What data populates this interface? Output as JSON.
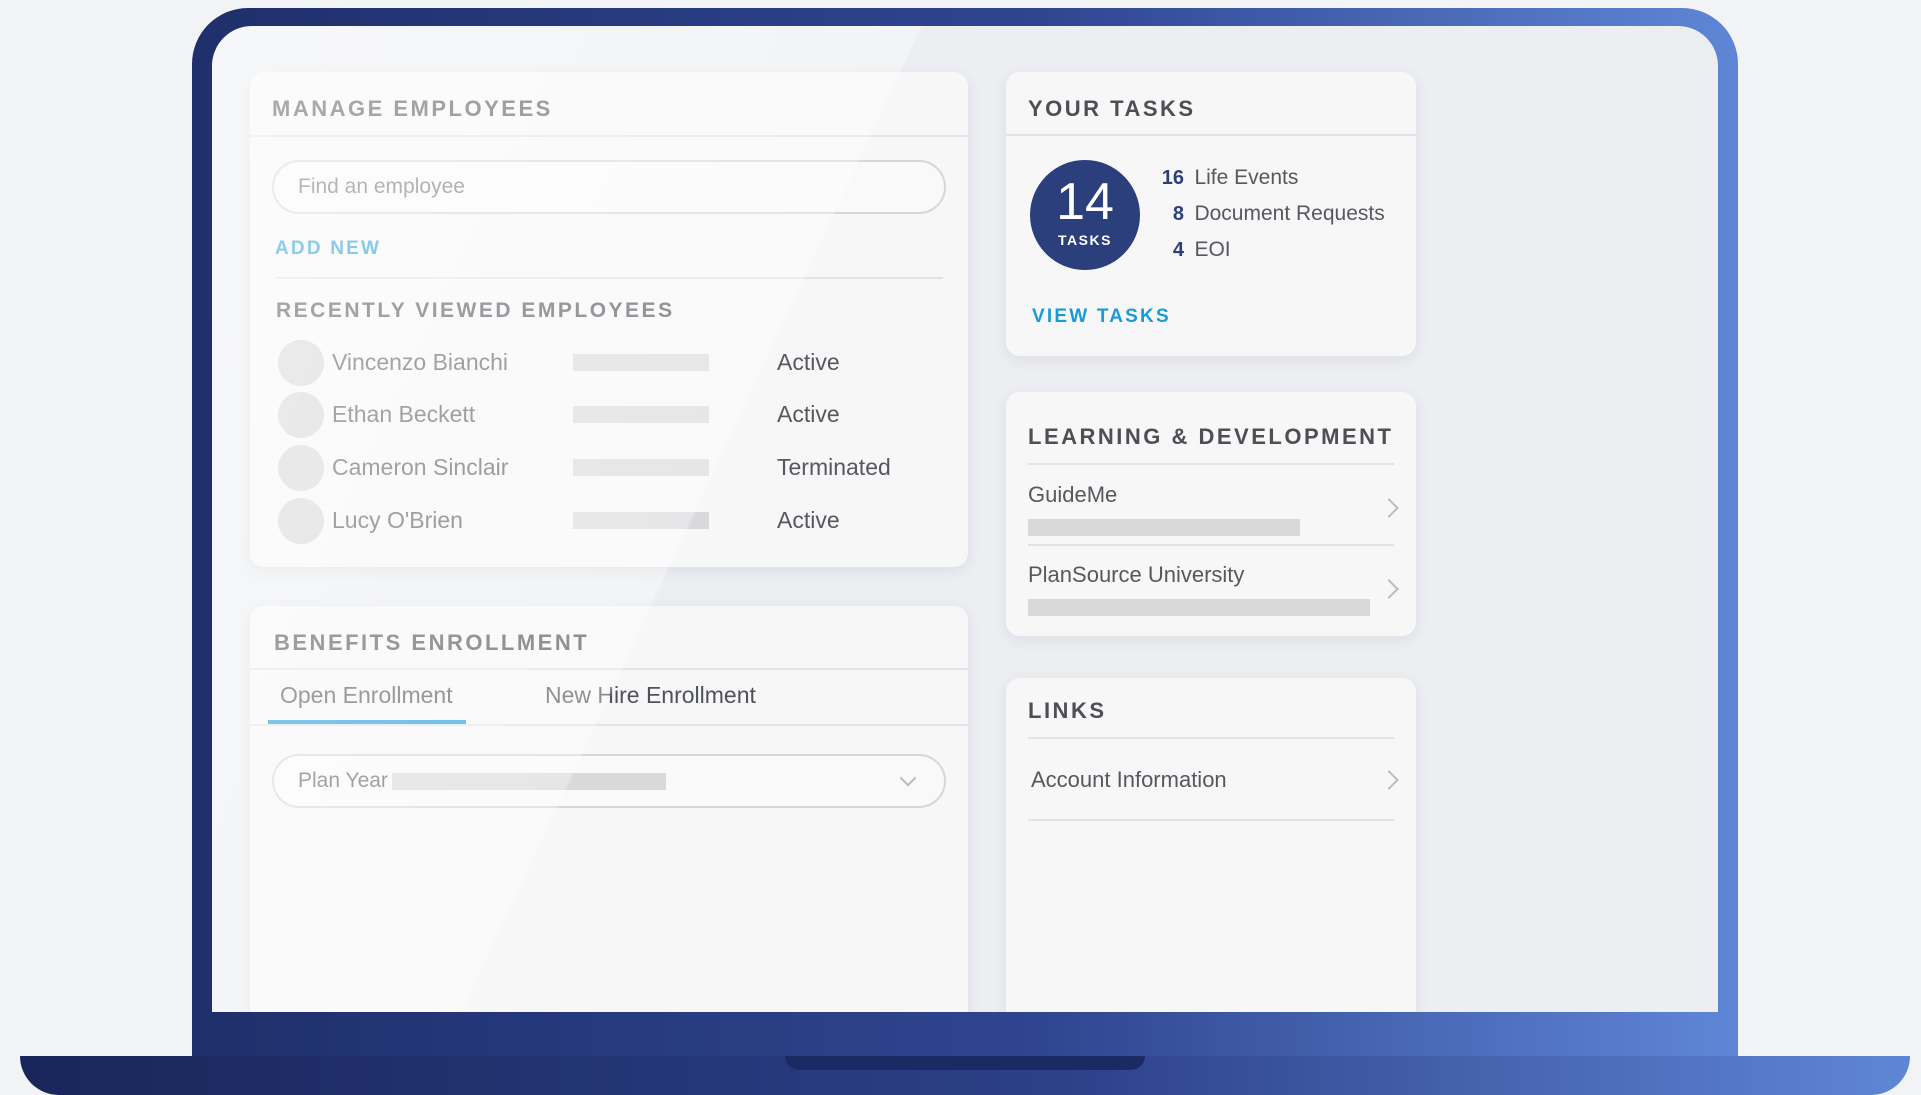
{
  "manage": {
    "title": "MANAGE EMPLOYEES",
    "search_placeholder": "Find an employee",
    "add_new": "ADD NEW",
    "recent_title": "RECENTLY VIEWED EMPLOYEES",
    "employees": [
      {
        "name": "Vincenzo Bianchi",
        "status": "Active"
      },
      {
        "name": "Ethan Beckett",
        "status": "Active"
      },
      {
        "name": "Cameron Sinclair",
        "status": "Terminated"
      },
      {
        "name": "Lucy O'Brien",
        "status": "Active"
      }
    ]
  },
  "tasks": {
    "title": "YOUR TASKS",
    "total": "14",
    "total_label": "TASKS",
    "items": [
      {
        "count": "16",
        "label": "Life Events"
      },
      {
        "count": "8",
        "label": "Document Requests"
      },
      {
        "count": "4",
        "label": "EOI"
      }
    ],
    "view_tasks": "VIEW TASKS"
  },
  "learning": {
    "title": "LEARNING & DEVELOPMENT",
    "items": [
      {
        "label": "GuideMe"
      },
      {
        "label": "PlanSource University"
      }
    ]
  },
  "benefits": {
    "title": "BENEFITS ENROLLMENT",
    "tabs": [
      {
        "label": "Open Enrollment",
        "active": true
      },
      {
        "label": "New Hire Enrollment",
        "active": false
      }
    ],
    "plan_year_label": "Plan Year"
  },
  "links": {
    "title": "LINKS",
    "items": [
      {
        "label": "Account Information"
      }
    ]
  },
  "colors": {
    "accent_link": "#1a9ad6",
    "tasks_circle": "#2c3f7d",
    "frame_dark": "#1f2f6b",
    "frame_light": "#5f86d6"
  }
}
